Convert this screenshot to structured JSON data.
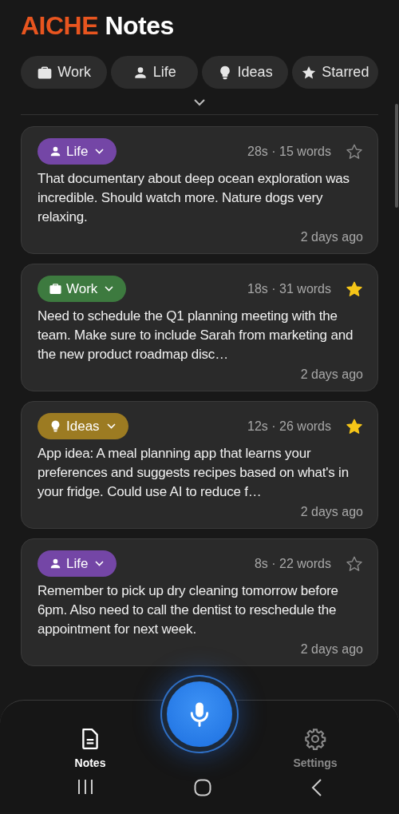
{
  "app_title": {
    "brand": "AICHE",
    "rest": "Notes"
  },
  "filters": [
    {
      "kind": "work",
      "label": "Work"
    },
    {
      "kind": "life",
      "label": "Life"
    },
    {
      "kind": "ideas",
      "label": "Ideas"
    },
    {
      "kind": "starred",
      "label": "Starred"
    }
  ],
  "notes": [
    {
      "tag": {
        "kind": "life",
        "label": "Life",
        "color": "#7446a6"
      },
      "meta": "28s · 15 words",
      "starred": false,
      "text": "That documentary about deep ocean exploration was incredible. Should watch more. Nature dogs very relaxing.",
      "time": "2 days ago"
    },
    {
      "tag": {
        "kind": "work",
        "label": "Work",
        "color": "#3d7a3f"
      },
      "meta": "18s · 31 words",
      "starred": true,
      "text": "Need to schedule the Q1 planning meeting with the team. Make sure to include Sarah from marketing and the new product roadmap disc…",
      "time": "2 days ago"
    },
    {
      "tag": {
        "kind": "ideas",
        "label": "Ideas",
        "color": "#9c7b22"
      },
      "meta": "12s · 26 words",
      "starred": true,
      "text": "App idea: A meal planning app that learns your preferences and suggests recipes based on what's in your fridge. Could use AI to reduce f…",
      "time": "2 days ago"
    },
    {
      "tag": {
        "kind": "life",
        "label": "Life",
        "color": "#7446a6"
      },
      "meta": "8s · 22 words",
      "starred": false,
      "text": "Remember to pick up dry cleaning tomorrow before 6pm. Also need to call the dentist to reschedule the appointment for next week.",
      "time": "2 days ago"
    }
  ],
  "bottom_nav": [
    {
      "kind": "notes",
      "label": "Notes",
      "selected": true
    },
    {
      "kind": "settings",
      "label": "Settings",
      "selected": false
    }
  ]
}
